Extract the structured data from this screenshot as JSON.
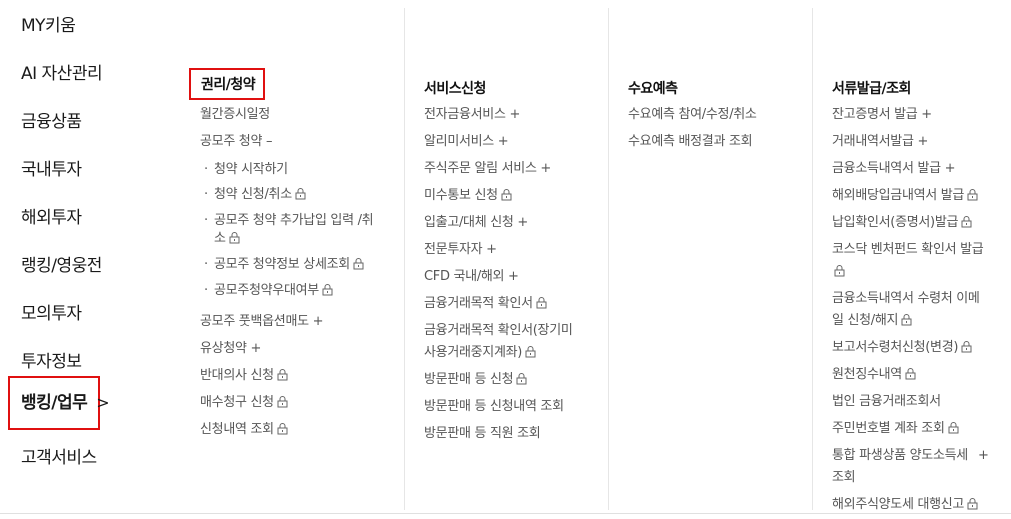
{
  "nav": {
    "items": [
      "MY키움",
      "AI 자산관리",
      "금융상품",
      "국내투자",
      "해외투자",
      "랭킹/영웅전",
      "모의투자",
      "투자정보",
      "뱅킹/업무",
      "고객서비스"
    ]
  },
  "col1": {
    "title": "권리/청약",
    "i0": "월간증시일정",
    "i1": "공모주 청약 –",
    "s0": "청약 시작하기",
    "s1": "청약 신청/취소",
    "s2a": "공모주 청약 추가납입 입력 /취",
    "s2b": "소",
    "s3": "공모주 청약정보 상세조회",
    "s4": "공모주청약우대여부",
    "i2": "공모주 풋백옵션매도 +",
    "i3": "유상청약 +",
    "i4": "반대의사 신청",
    "i5": "매수청구 신청",
    "i6": "신청내역 조회"
  },
  "col2": {
    "title": "서비스신청",
    "i0": "전자금융서비스 +",
    "i1": "알리미서비스 +",
    "i2": "주식주문 알림 서비스 +",
    "i3": "미수통보 신청",
    "i4": "입출고/대체 신청 +",
    "i5": "전문투자자 +",
    "i6": "CFD 국내/해외 +",
    "i7": "금융거래목적 확인서",
    "i8a": "금융거래목적 확인서(장기미",
    "i8b": "사용거래중지계좌)",
    "i9": "방문판매 등 신청",
    "i10": "방문판매 등 신청내역 조회",
    "i11": "방문판매 등 직원 조회"
  },
  "col3": {
    "title": "수요예측",
    "i0": "수요예측 참여/수정/취소",
    "i1": "수요예측 배정결과 조회"
  },
  "col4": {
    "title": "서류발급/조회",
    "i0": "잔고증명서 발급 +",
    "i1": "거래내역서발급 +",
    "i2": "금융소득내역서 발급 +",
    "i3": "해외배당입금내역서 발급",
    "i4": "납입확인서(증명서)발급",
    "i5": "코스닥 벤처펀드 확인서 발급",
    "i6a": "금융소득내역서 수령처 이메",
    "i6b": "일 신청/해지",
    "i7": "보고서수령처신청(변경)",
    "i8": "원천징수내역",
    "i9": "법인 금융거래조회서",
    "i10": "주민번호별 계좌 조회",
    "i11a": "통합 파생상품 양도소득세",
    "i11b": "조회",
    "i11plus": "+",
    "i12": "해외주식양도세 대행신고"
  }
}
